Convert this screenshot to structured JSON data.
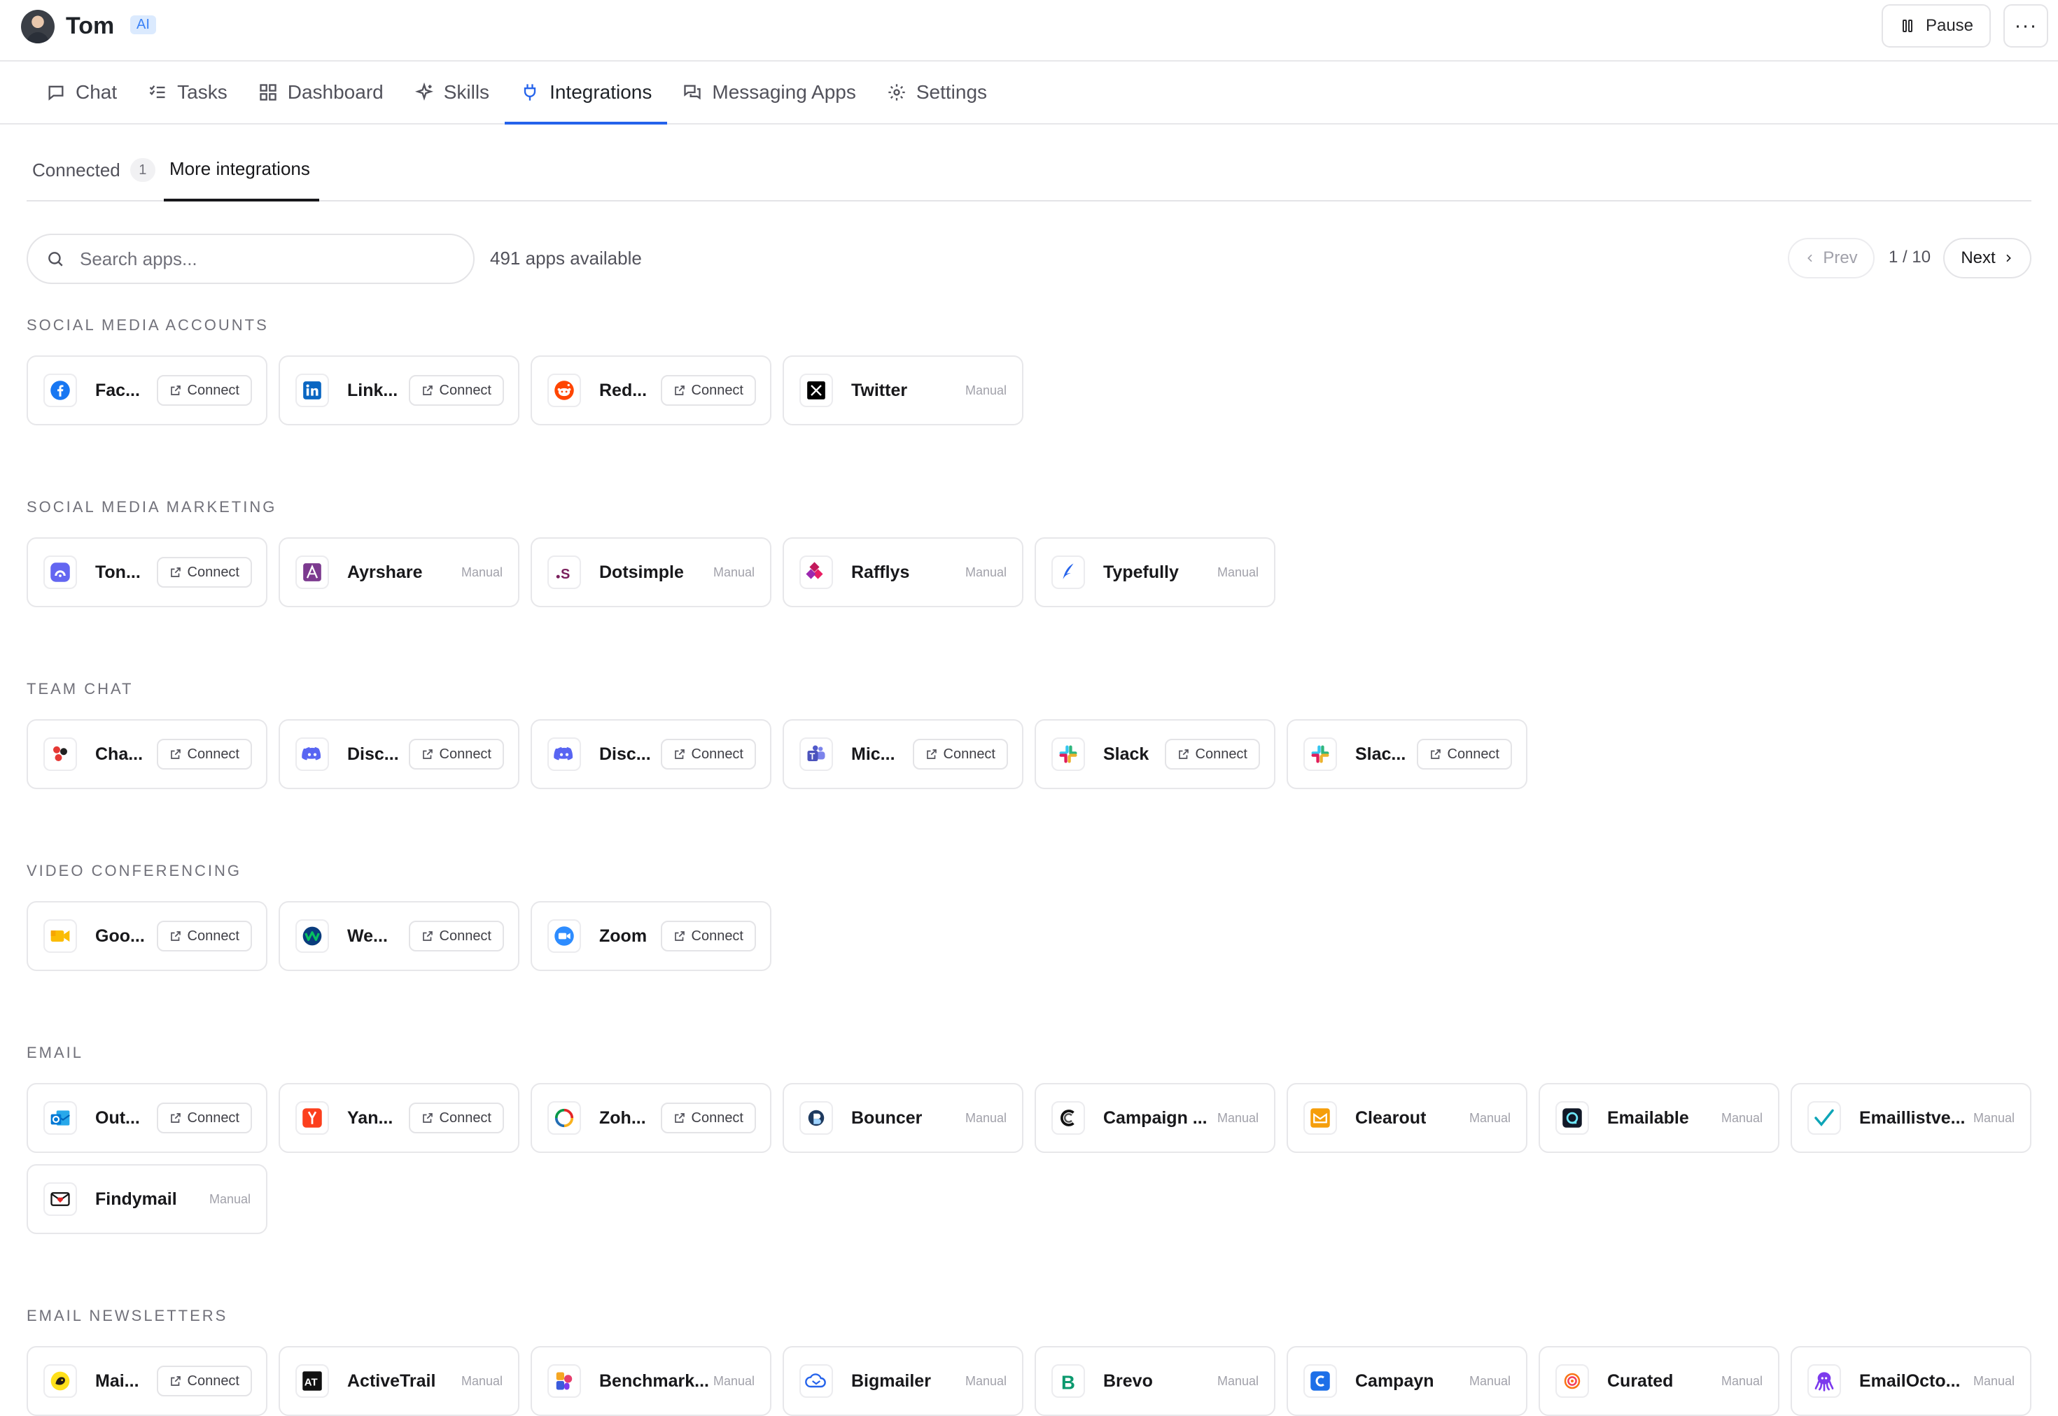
{
  "header": {
    "user_name": "Tom",
    "badge": "AI",
    "pause_label": "Pause",
    "more_label": "···"
  },
  "nav": {
    "tabs": [
      {
        "label": "Chat",
        "icon": "chat-bubble-icon"
      },
      {
        "label": "Tasks",
        "icon": "checklist-icon"
      },
      {
        "label": "Dashboard",
        "icon": "grid-icon"
      },
      {
        "label": "Skills",
        "icon": "sparkles-icon"
      },
      {
        "label": "Integrations",
        "icon": "plug-icon",
        "active": true
      },
      {
        "label": "Messaging Apps",
        "icon": "messages-icon"
      },
      {
        "label": "Settings",
        "icon": "gear-icon"
      }
    ]
  },
  "subtabs": {
    "connected_label": "Connected",
    "connected_count": "1",
    "more_label": "More integrations"
  },
  "search": {
    "placeholder": "Search apps...",
    "apps_available": "491 apps available"
  },
  "pagination": {
    "prev_label": "Prev",
    "page": "1 / 10",
    "next_label": "Next"
  },
  "labels": {
    "connect": "Connect",
    "manual": "Manual"
  },
  "sections": [
    {
      "title": "SOCIAL MEDIA ACCOUNTS",
      "apps": [
        {
          "name": "Fac...",
          "action": "Connect",
          "icon": "facebook-icon",
          "color": "#1877f2"
        },
        {
          "name": "Link...",
          "action": "Connect",
          "icon": "linkedin-icon",
          "color": "#0a66c2"
        },
        {
          "name": "Red...",
          "action": "Connect",
          "icon": "reddit-icon",
          "color": "#ff4500"
        },
        {
          "name": "Twitter",
          "action": "Manual",
          "icon": "x-twitter-icon",
          "color": "#000000"
        }
      ]
    },
    {
      "title": "SOCIAL MEDIA MARKETING",
      "apps": [
        {
          "name": "Ton...",
          "action": "Connect",
          "icon": "tonic-icon",
          "color": "#6366f1"
        },
        {
          "name": "Ayrshare",
          "action": "Manual",
          "icon": "ayrshare-icon",
          "color": "#7c3a8f"
        },
        {
          "name": "Dotsimple",
          "action": "Manual",
          "icon": "dotsimple-icon",
          "color": "#7a1f5c"
        },
        {
          "name": "Rafflys",
          "action": "Manual",
          "icon": "rafflys-icon",
          "color": "#c2185b"
        },
        {
          "name": "Typefully",
          "action": "Manual",
          "icon": "typefully-icon",
          "color": "#2563eb"
        }
      ]
    },
    {
      "title": "TEAM CHAT",
      "apps": [
        {
          "name": "Cha...",
          "action": "Connect",
          "icon": "chatwork-icon",
          "color": "#e53935"
        },
        {
          "name": "Disc...",
          "action": "Connect",
          "icon": "discord-icon",
          "color": "#5865f2"
        },
        {
          "name": "Disc...",
          "action": "Connect",
          "icon": "discord-icon",
          "color": "#5865f2"
        },
        {
          "name": "Mic...",
          "action": "Connect",
          "icon": "teams-icon",
          "color": "#5059c9"
        },
        {
          "name": "Slack",
          "action": "Connect",
          "icon": "slack-icon",
          "color": "#e01e5a"
        },
        {
          "name": "Slac...",
          "action": "Connect",
          "icon": "slack-icon",
          "color": "#e01e5a"
        }
      ]
    },
    {
      "title": "VIDEO CONFERENCING",
      "apps": [
        {
          "name": "Goo...",
          "action": "Connect",
          "icon": "google-meet-icon",
          "color": "#fbbc04"
        },
        {
          "name": "We...",
          "action": "Connect",
          "icon": "webex-icon",
          "color": "#07c160"
        },
        {
          "name": "Zoom",
          "action": "Connect",
          "icon": "zoom-icon",
          "color": "#2d8cff"
        }
      ]
    },
    {
      "title": "EMAIL",
      "apps": [
        {
          "name": "Out...",
          "action": "Connect",
          "icon": "outlook-icon",
          "color": "#0078d4"
        },
        {
          "name": "Yan...",
          "action": "Connect",
          "icon": "yandex-icon",
          "color": "#fc3f1d"
        },
        {
          "name": "Zoh...",
          "action": "Connect",
          "icon": "zoho-icon",
          "color": "#e42527"
        },
        {
          "name": "Bouncer",
          "action": "Manual",
          "icon": "bouncer-icon",
          "color": "#1e3a5f"
        },
        {
          "name": "Campaign ...",
          "action": "Manual",
          "icon": "campaign-monitor-icon",
          "color": "#111111"
        },
        {
          "name": "Clearout",
          "action": "Manual",
          "icon": "clearout-icon",
          "color": "#f59e0b"
        },
        {
          "name": "Emailable",
          "action": "Manual",
          "icon": "emailable-icon",
          "color": "#111827"
        },
        {
          "name": "Emaillistve...",
          "action": "Manual",
          "icon": "checkmark-icon",
          "color": "#0ea5b7"
        },
        {
          "name": "Findymail",
          "action": "Manual",
          "icon": "findymail-icon",
          "color": "#dc2626"
        }
      ]
    },
    {
      "title": "EMAIL NEWSLETTERS",
      "apps": [
        {
          "name": "Mai...",
          "action": "Connect",
          "icon": "mailchimp-icon",
          "color": "#ffe01b"
        },
        {
          "name": "ActiveTrail",
          "action": "Manual",
          "icon": "activetrail-icon",
          "color": "#111111"
        },
        {
          "name": "Benchmark...",
          "action": "Manual",
          "icon": "benchmark-icon",
          "color": "#e63e6d"
        },
        {
          "name": "Bigmailer",
          "action": "Manual",
          "icon": "bigmailer-icon",
          "color": "#2563eb"
        },
        {
          "name": "Brevo",
          "action": "Manual",
          "icon": "brevo-icon",
          "color": "#0b996e"
        },
        {
          "name": "Campayn",
          "action": "Manual",
          "icon": "campayn-icon",
          "color": "#1d6fe8"
        },
        {
          "name": "Curated",
          "action": "Manual",
          "icon": "curated-icon",
          "color": "#f97316"
        },
        {
          "name": "EmailOcto...",
          "action": "Manual",
          "icon": "emailoctopus-icon",
          "color": "#7c3aed"
        }
      ]
    }
  ]
}
